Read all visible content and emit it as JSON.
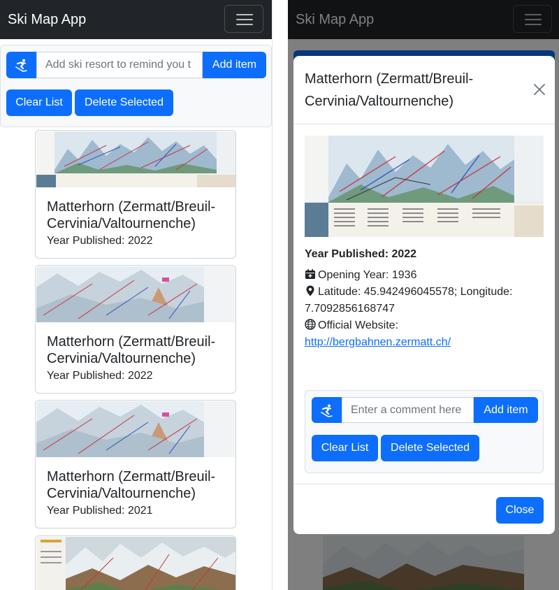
{
  "app": {
    "brand": "Ski Map App"
  },
  "colors": {
    "primary": "#0d6efd",
    "navbar": "#212529"
  },
  "add_form": {
    "icon": "skier-icon",
    "placeholder": "Add ski resort to remind you t",
    "add_label": "Add item",
    "clear_label": "Clear List",
    "delete_label": "Delete Selected"
  },
  "resorts": [
    {
      "title": "Matterhorn (Zermatt/Breuil-Cervinia/Valtournenche)",
      "year": "Year Published: 2022"
    },
    {
      "title": "Matterhorn (Zermatt/Breuil-Cervinia/Valtournenche)",
      "year": "Year Published: 2022"
    },
    {
      "title": "Matterhorn (Zermatt/Breuil-Cervinia/Valtournenche)",
      "year": "Year Published: 2021"
    }
  ],
  "modal": {
    "title": "Matterhorn (Zermatt/Breuil-Cervinia/Valtournenche)",
    "year": "Year Published: 2022",
    "opening": "Opening Year: 1936",
    "coords": "Latitude: 45.942496045578; Longitude: 7.7092856168747",
    "website_label": "Official Website:",
    "website_url": "http://bergbahnen.zermatt.ch/",
    "comment_placeholder": "Enter a comment here",
    "add_label": "Add item",
    "clear_label": "Clear List",
    "delete_label": "Delete Selected",
    "close_label": "Close"
  }
}
